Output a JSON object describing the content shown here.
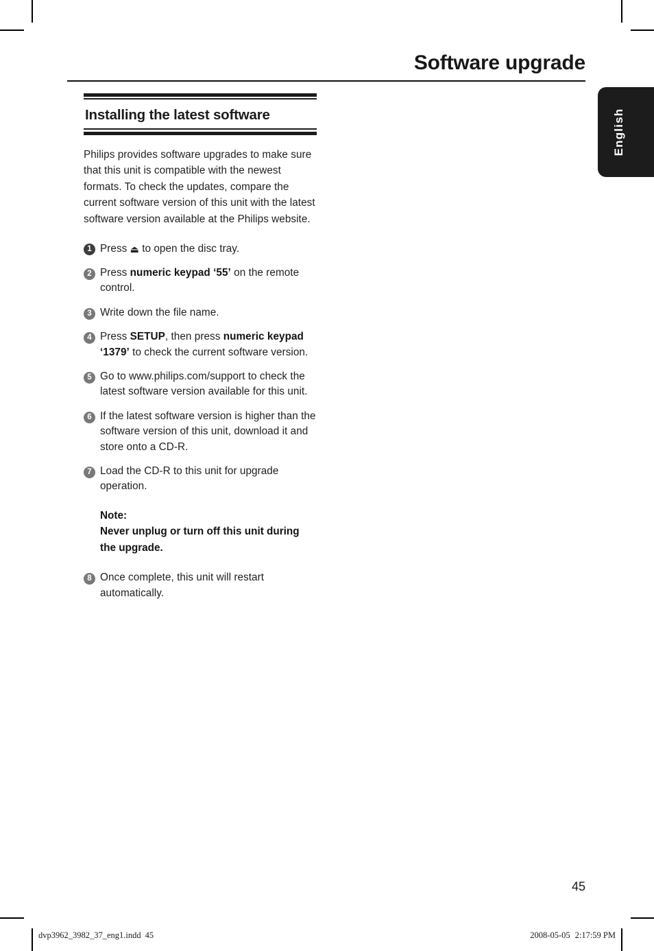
{
  "crop_marks": {
    "visible": true,
    "color": "#000000"
  },
  "header": {
    "title": "Software upgrade"
  },
  "language_tab": {
    "label": "English",
    "bg_color": "#1c1c1c",
    "text_color": "#ffffff"
  },
  "section": {
    "heading": "Installing the latest software",
    "intro": "Philips provides software upgrades to make sure that this unit is compatible with the newest formats.  To check the updates, compare the current software version of this unit with the latest software version available at the Philips website."
  },
  "steps": [
    {
      "number": "1",
      "prefix": "Press ",
      "icon": "eject-icon",
      "icon_glyph": "⏏",
      "suffix": " to open the disc tray.",
      "bold": ""
    },
    {
      "number": "2",
      "prefix": "Press ",
      "bold": "numeric keypad ‘55’",
      "suffix": " on the remote control."
    },
    {
      "number": "3",
      "prefix": "Write down the file name.",
      "bold": "",
      "suffix": ""
    },
    {
      "number": "4",
      "prefix": "Press ",
      "bold": "SETUP",
      "mid": ", then press ",
      "bold2": "numeric keypad ‘1379’",
      "suffix": " to check the current software version."
    },
    {
      "number": "5",
      "prefix": "Go to www.philips.com/support to check the latest software version available for this unit.",
      "bold": "",
      "suffix": ""
    },
    {
      "number": "6",
      "prefix": "If the latest software version is higher than the software version of this unit, download it and store onto a CD-R.",
      "bold": "",
      "suffix": ""
    },
    {
      "number": "7",
      "prefix": "Load the CD-R to this unit for upgrade operation.",
      "bold": "",
      "suffix": ""
    },
    {
      "number": "8",
      "prefix": "Once complete, this unit will restart automatically.",
      "bold": "",
      "suffix": ""
    }
  ],
  "note": {
    "label": "Note:",
    "text": "Never unplug or turn off this unit during the upgrade."
  },
  "page_number": "45",
  "footer": {
    "filename": "dvp3962_3982_37_eng1.indd",
    "file_page": "45",
    "date": "2008-05-05",
    "time": "2:17:59 PM"
  }
}
